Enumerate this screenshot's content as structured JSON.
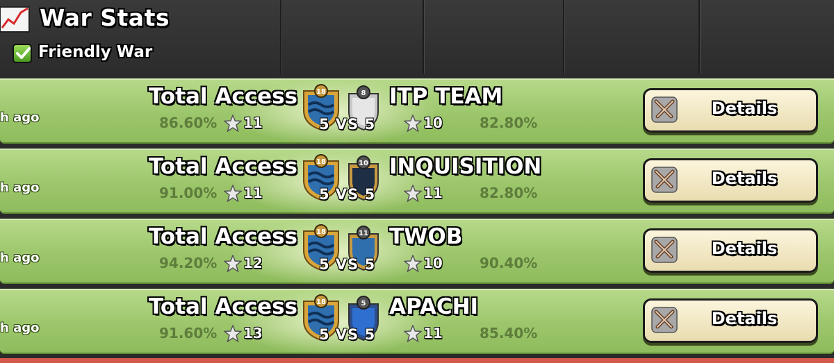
{
  "header": {
    "title": "War Stats",
    "filter_label": "Friendly War",
    "filter_checked": true
  },
  "wars": [
    {
      "time_ago": "h ago",
      "clan": "Total Access",
      "clan_level": "18",
      "clan_pct": "86.60%",
      "clan_stars": "11",
      "score": "5 VS 5",
      "opponent": "ITP TEAM",
      "opponent_level": "8",
      "opponent_stars": "10",
      "opponent_pct": "82.80%",
      "details_label": "Details"
    },
    {
      "time_ago": "h ago",
      "clan": "Total Access",
      "clan_level": "18",
      "clan_pct": "91.00%",
      "clan_stars": "11",
      "score": "5 VS 5",
      "opponent": "INQUISITION",
      "opponent_level": "10",
      "opponent_stars": "11",
      "opponent_pct": "82.80%",
      "details_label": "Details"
    },
    {
      "time_ago": "h ago",
      "clan": "Total Access",
      "clan_level": "18",
      "clan_pct": "94.20%",
      "clan_stars": "12",
      "score": "5 VS 5",
      "opponent": "TWOB",
      "opponent_level": "11",
      "opponent_stars": "10",
      "opponent_pct": "90.40%",
      "details_label": "Details"
    },
    {
      "time_ago": "h ago",
      "clan": "Total Access",
      "clan_level": "18",
      "clan_pct": "91.60%",
      "clan_stars": "13",
      "score": "5 VS 5",
      "opponent": "APACHI",
      "opponent_level": "5",
      "opponent_stars": "11",
      "opponent_pct": "85.40%",
      "details_label": "Details"
    }
  ],
  "colors": {
    "row_green": "#9cc66b",
    "header_dark": "#2c2c2c",
    "button_cream": "#fbf5dc",
    "pct_text": "#5e7d3c"
  },
  "icons": {
    "header": "chart-icon",
    "filter": "checkmark-icon",
    "star": "star-icon",
    "details": "crossed-swords-icon"
  }
}
